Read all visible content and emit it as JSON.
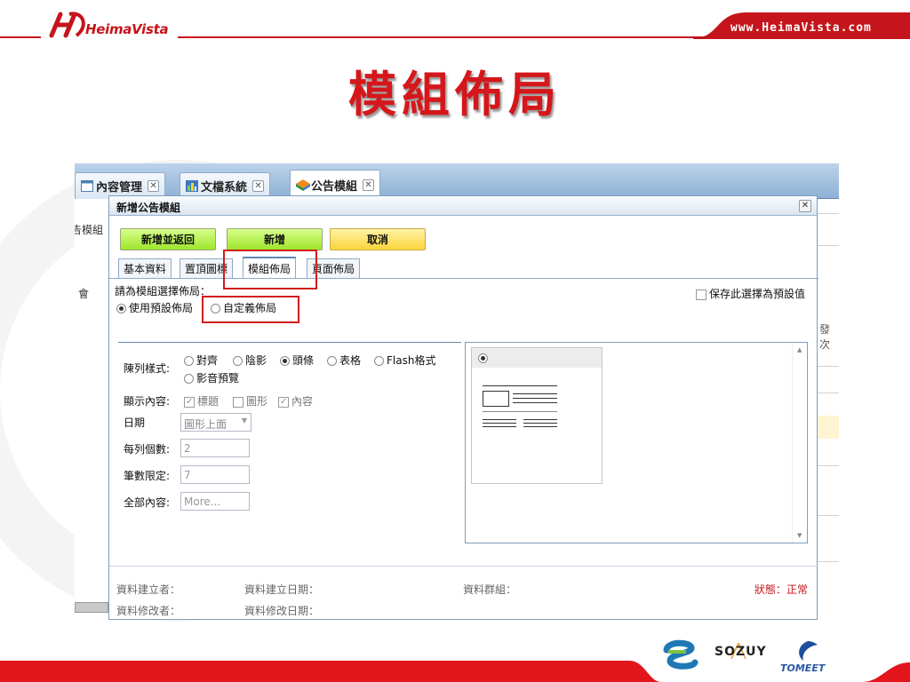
{
  "slide": {
    "brand_name": "HeimaVista",
    "url": "www.HeimaVista.com",
    "title": "模組佈局",
    "bottom_logos": [
      "SOZUY",
      "TOMEET"
    ]
  },
  "app_tabs": [
    {
      "label": "內容管理",
      "icon": "window-icon"
    },
    {
      "label": "文檔系統",
      "icon": "document-chart-icon"
    },
    {
      "label": "公告模組",
      "icon": "announcement-cube-icon"
    }
  ],
  "background": {
    "left_label_1": "告模組",
    "left_label_2": "會",
    "right_fragment": "發次"
  },
  "dialog": {
    "title": "新增公告模組",
    "buttons": {
      "save_return": "新增並返回",
      "add": "新增",
      "cancel": "取消"
    },
    "tabs": [
      "基本資料",
      "置頂圖標",
      "模組佈局",
      "頁面佈局"
    ],
    "active_tab_index": 2,
    "prompt": "請為模組選擇佈局：",
    "layout_options": {
      "default_label": "使用預設佈局",
      "custom_label": "自定義佈局",
      "selected": "default"
    },
    "save_default_label": "保存此選擇為預設值",
    "form": {
      "display_style": {
        "label": "陳列樣式:",
        "options": [
          "對齊",
          "陰影",
          "頭條",
          "表格",
          "Flash格式",
          "影音預覽"
        ],
        "selected": "頭條"
      },
      "display_content": {
        "label": "顯示內容:",
        "options": [
          {
            "label": "標題",
            "checked": true
          },
          {
            "label": "圖形",
            "checked": false
          },
          {
            "label": "內容",
            "checked": true
          }
        ]
      },
      "date": {
        "label": "日期",
        "value": "圖形上面"
      },
      "per_row": {
        "label": "每列個數:",
        "value": "2"
      },
      "limit": {
        "label": "筆數限定:",
        "value": "7"
      },
      "all_content": {
        "label": "全部內容:",
        "placeholder": "More..."
      }
    },
    "footer": {
      "creator_label": "資料建立者：",
      "create_date_label": "資料建立日期：",
      "group_label": "資料群組：",
      "status_label": "狀態：正常",
      "modifier_label": "資料修改者：",
      "modify_date_label": "資料修改日期："
    }
  },
  "colors": {
    "brand_red": "#d5171b",
    "tab_bar_blue": "#9fbcdc",
    "button_green": "#a6e83a",
    "button_yellow": "#fcd84a",
    "highlight_box": "#d11d1d"
  }
}
